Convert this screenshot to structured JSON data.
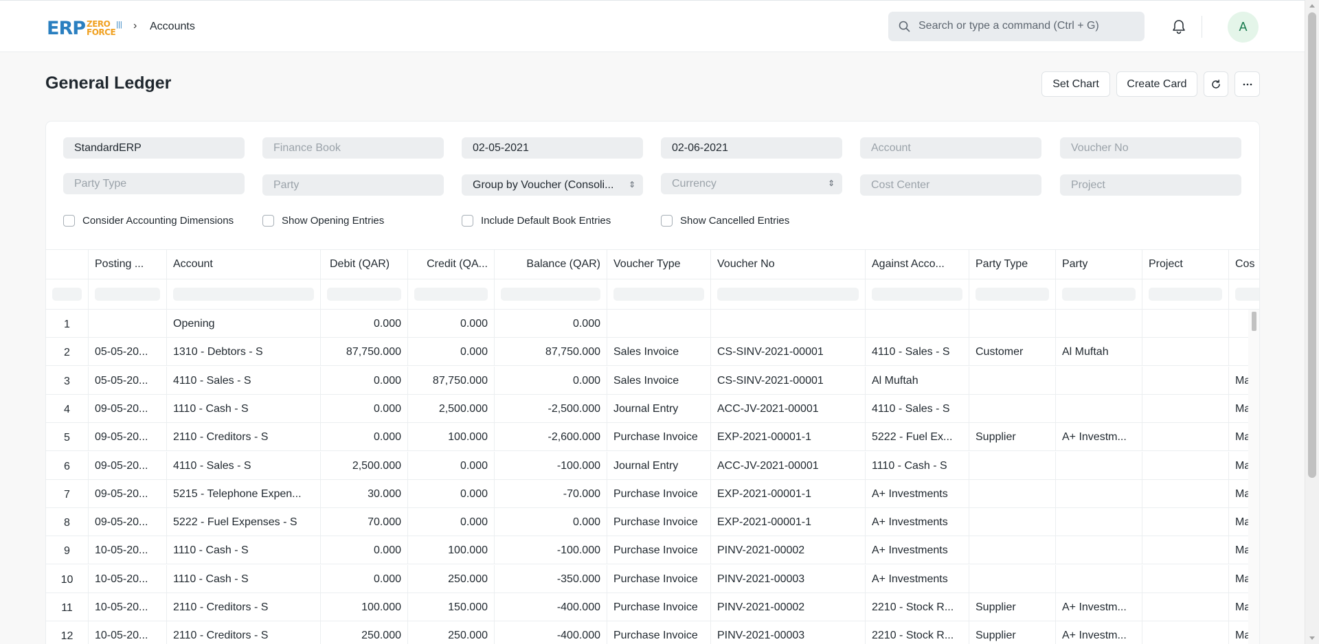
{
  "navbar": {
    "logo_main": "ERP",
    "logo_sub1": "ZERO",
    "logo_sub2": "FORCE",
    "breadcrumb": "Accounts",
    "search_placeholder": "Search or type a command (Ctrl + G)",
    "avatar_initial": "A"
  },
  "page": {
    "title": "General Ledger",
    "buttons": {
      "set_chart": "Set Chart",
      "create_card": "Create Card"
    }
  },
  "filters": {
    "company": "StandardERP",
    "finance_book": "Finance Book",
    "from_date": "02-05-2021",
    "to_date": "02-06-2021",
    "account": "Account",
    "voucher_no": "Voucher No",
    "party_type": "Party Type",
    "party": "Party",
    "group_by": "Group by Voucher (Consoli...",
    "currency": "Currency",
    "cost_center": "Cost Center",
    "project": "Project",
    "checks": [
      "Consider Accounting Dimensions",
      "Show Opening Entries",
      "Include Default Book Entries",
      "Show Cancelled Entries"
    ]
  },
  "table": {
    "columns": [
      "",
      "Posting ...",
      "Account",
      "Debit (QAR)",
      "Credit (QA...",
      "Balance (QAR)",
      "Voucher Type",
      "Voucher No",
      "Against Acco...",
      "Party Type",
      "Party",
      "Project",
      "Cos"
    ],
    "rows": [
      [
        "1",
        "",
        "Opening",
        "0.000",
        "0.000",
        "0.000",
        "",
        "",
        "",
        "",
        "",
        "",
        ""
      ],
      [
        "2",
        "05-05-20...",
        "1310 - Debtors - S",
        "87,750.000",
        "0.000",
        "87,750.000",
        "Sales Invoice",
        "CS-SINV-2021-00001",
        "4110 - Sales - S",
        "Customer",
        "Al Muftah",
        "",
        ""
      ],
      [
        "3",
        "05-05-20...",
        "4110 - Sales - S",
        "0.000",
        "87,750.000",
        "0.000",
        "Sales Invoice",
        "CS-SINV-2021-00001",
        "Al Muftah",
        "",
        "",
        "",
        "Ma"
      ],
      [
        "4",
        "09-05-20...",
        "1110 - Cash - S",
        "0.000",
        "2,500.000",
        "-2,500.000",
        "Journal Entry",
        "ACC-JV-2021-00001",
        "4110 - Sales - S",
        "",
        "",
        "",
        "Ma"
      ],
      [
        "5",
        "09-05-20...",
        "2110 - Creditors - S",
        "0.000",
        "100.000",
        "-2,600.000",
        "Purchase Invoice",
        "EXP-2021-00001-1",
        "5222 - Fuel Ex...",
        "Supplier",
        "A+ Investm...",
        "",
        "Ma"
      ],
      [
        "6",
        "09-05-20...",
        "4110 - Sales - S",
        "2,500.000",
        "0.000",
        "-100.000",
        "Journal Entry",
        "ACC-JV-2021-00001",
        "1110 - Cash - S",
        "",
        "",
        "",
        "Ma"
      ],
      [
        "7",
        "09-05-20...",
        "5215 - Telephone Expen...",
        "30.000",
        "0.000",
        "-70.000",
        "Purchase Invoice",
        "EXP-2021-00001-1",
        "A+ Investments",
        "",
        "",
        "",
        "Ma"
      ],
      [
        "8",
        "09-05-20...",
        "5222 - Fuel Expenses - S",
        "70.000",
        "0.000",
        "0.000",
        "Purchase Invoice",
        "EXP-2021-00001-1",
        "A+ Investments",
        "",
        "",
        "",
        "Ma"
      ],
      [
        "9",
        "10-05-20...",
        "1110 - Cash - S",
        "0.000",
        "100.000",
        "-100.000",
        "Purchase Invoice",
        "PINV-2021-00002",
        "A+ Investments",
        "",
        "",
        "",
        "Ma"
      ],
      [
        "10",
        "10-05-20...",
        "1110 - Cash - S",
        "0.000",
        "250.000",
        "-350.000",
        "Purchase Invoice",
        "PINV-2021-00003",
        "A+ Investments",
        "",
        "",
        "",
        "Ma"
      ],
      [
        "11",
        "10-05-20...",
        "2110 - Creditors - S",
        "100.000",
        "150.000",
        "-400.000",
        "Purchase Invoice",
        "PINV-2021-00002",
        "2210 - Stock R...",
        "Supplier",
        "A+ Investm...",
        "",
        "Ma"
      ],
      [
        "12",
        "10-05-20...",
        "2110 - Creditors - S",
        "250.000",
        "250.000",
        "-400.000",
        "Purchase Invoice",
        "PINV-2021-00003",
        "2210 - Stock R...",
        "Supplier",
        "A+ Investm...",
        "",
        "Ma"
      ]
    ]
  }
}
